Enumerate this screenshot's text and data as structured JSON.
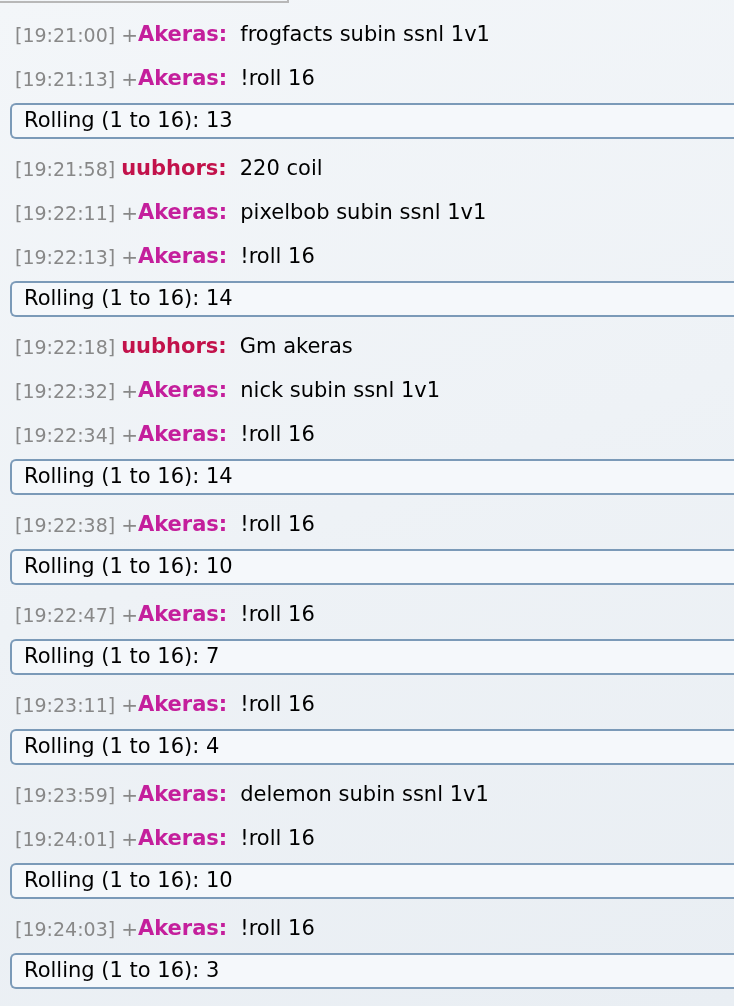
{
  "chat": [
    {
      "kind": "message",
      "time": "[19:21:00]",
      "rank": "+",
      "user": "Akeras:",
      "color": "#c41f9c",
      "text": "frogfacts subin ssnl 1v1"
    },
    {
      "kind": "message",
      "time": "[19:21:13]",
      "rank": "+",
      "user": "Akeras:",
      "color": "#c41f9c",
      "text": "!roll 16"
    },
    {
      "kind": "roll",
      "text": "Rolling (1 to 16): 13"
    },
    {
      "kind": "message",
      "time": "[19:21:58]",
      "user": "uubhors:",
      "color": "#c2124b",
      "text": "220 coil"
    },
    {
      "kind": "message",
      "time": "[19:22:11]",
      "rank": "+",
      "user": "Akeras:",
      "color": "#c41f9c",
      "text": "pixelbob subin ssnl 1v1"
    },
    {
      "kind": "message",
      "time": "[19:22:13]",
      "rank": "+",
      "user": "Akeras:",
      "color": "#c41f9c",
      "text": "!roll 16"
    },
    {
      "kind": "roll",
      "text": "Rolling (1 to 16): 14"
    },
    {
      "kind": "message",
      "time": "[19:22:18]",
      "user": "uubhors:",
      "color": "#c2124b",
      "text": "Gm akeras"
    },
    {
      "kind": "message",
      "time": "[19:22:32]",
      "rank": "+",
      "user": "Akeras:",
      "color": "#c41f9c",
      "text": "nick subin ssnl 1v1"
    },
    {
      "kind": "message",
      "time": "[19:22:34]",
      "rank": "+",
      "user": "Akeras:",
      "color": "#c41f9c",
      "text": "!roll 16"
    },
    {
      "kind": "roll",
      "text": "Rolling (1 to 16): 14"
    },
    {
      "kind": "message",
      "time": "[19:22:38]",
      "rank": "+",
      "user": "Akeras:",
      "color": "#c41f9c",
      "text": "!roll 16"
    },
    {
      "kind": "roll",
      "text": "Rolling (1 to 16): 10"
    },
    {
      "kind": "message",
      "time": "[19:22:47]",
      "rank": "+",
      "user": "Akeras:",
      "color": "#c41f9c",
      "text": "!roll 16"
    },
    {
      "kind": "roll",
      "text": "Rolling (1 to 16): 7"
    },
    {
      "kind": "message",
      "time": "[19:23:11]",
      "rank": "+",
      "user": "Akeras:",
      "color": "#c41f9c",
      "text": "!roll 16"
    },
    {
      "kind": "roll",
      "text": "Rolling (1 to 16): 4"
    },
    {
      "kind": "message",
      "time": "[19:23:59]",
      "rank": "+",
      "user": "Akeras:",
      "color": "#c41f9c",
      "text": "delemon subin ssnl 1v1"
    },
    {
      "kind": "message",
      "time": "[19:24:01]",
      "rank": "+",
      "user": "Akeras:",
      "color": "#c41f9c",
      "text": "!roll 16"
    },
    {
      "kind": "roll",
      "text": "Rolling (1 to 16): 10"
    },
    {
      "kind": "message",
      "time": "[19:24:03]",
      "rank": "+",
      "user": "Akeras:",
      "color": "#c41f9c",
      "text": "!roll 16"
    },
    {
      "kind": "roll",
      "text": "Rolling (1 to 16): 3"
    }
  ]
}
